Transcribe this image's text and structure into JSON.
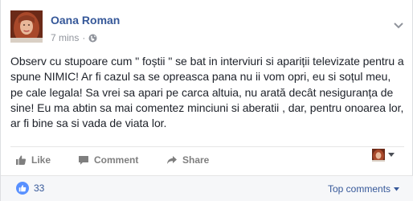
{
  "post": {
    "author": "Oana Roman",
    "time": "7 mins",
    "separator": "·",
    "privacy_icon": "globe-icon",
    "text": "Observ cu stupoare cum \" foștii \" se bat in interviuri si apariții televizate pentru a spune NIMIC! Ar fi cazul sa se opreasca pana nu ii vom opri, eu si soțul meu, pe cale legala! Sa vrei sa apari pe carca altuia, nu arată decât nesiguranța de sine! Eu ma abtin sa mai comentez minciuni si aberatii , dar, pentru onoarea lor, ar fi bine sa si vada de viata lor."
  },
  "actions": {
    "like_label": "Like",
    "comment_label": "Comment",
    "share_label": "Share"
  },
  "footer": {
    "like_count": "33",
    "sort_label": "Top comments"
  },
  "colors": {
    "link_blue": "#365899",
    "meta_gray": "#90949c",
    "action_gray": "#7f7f7f",
    "like_badge": "#5890ff"
  }
}
